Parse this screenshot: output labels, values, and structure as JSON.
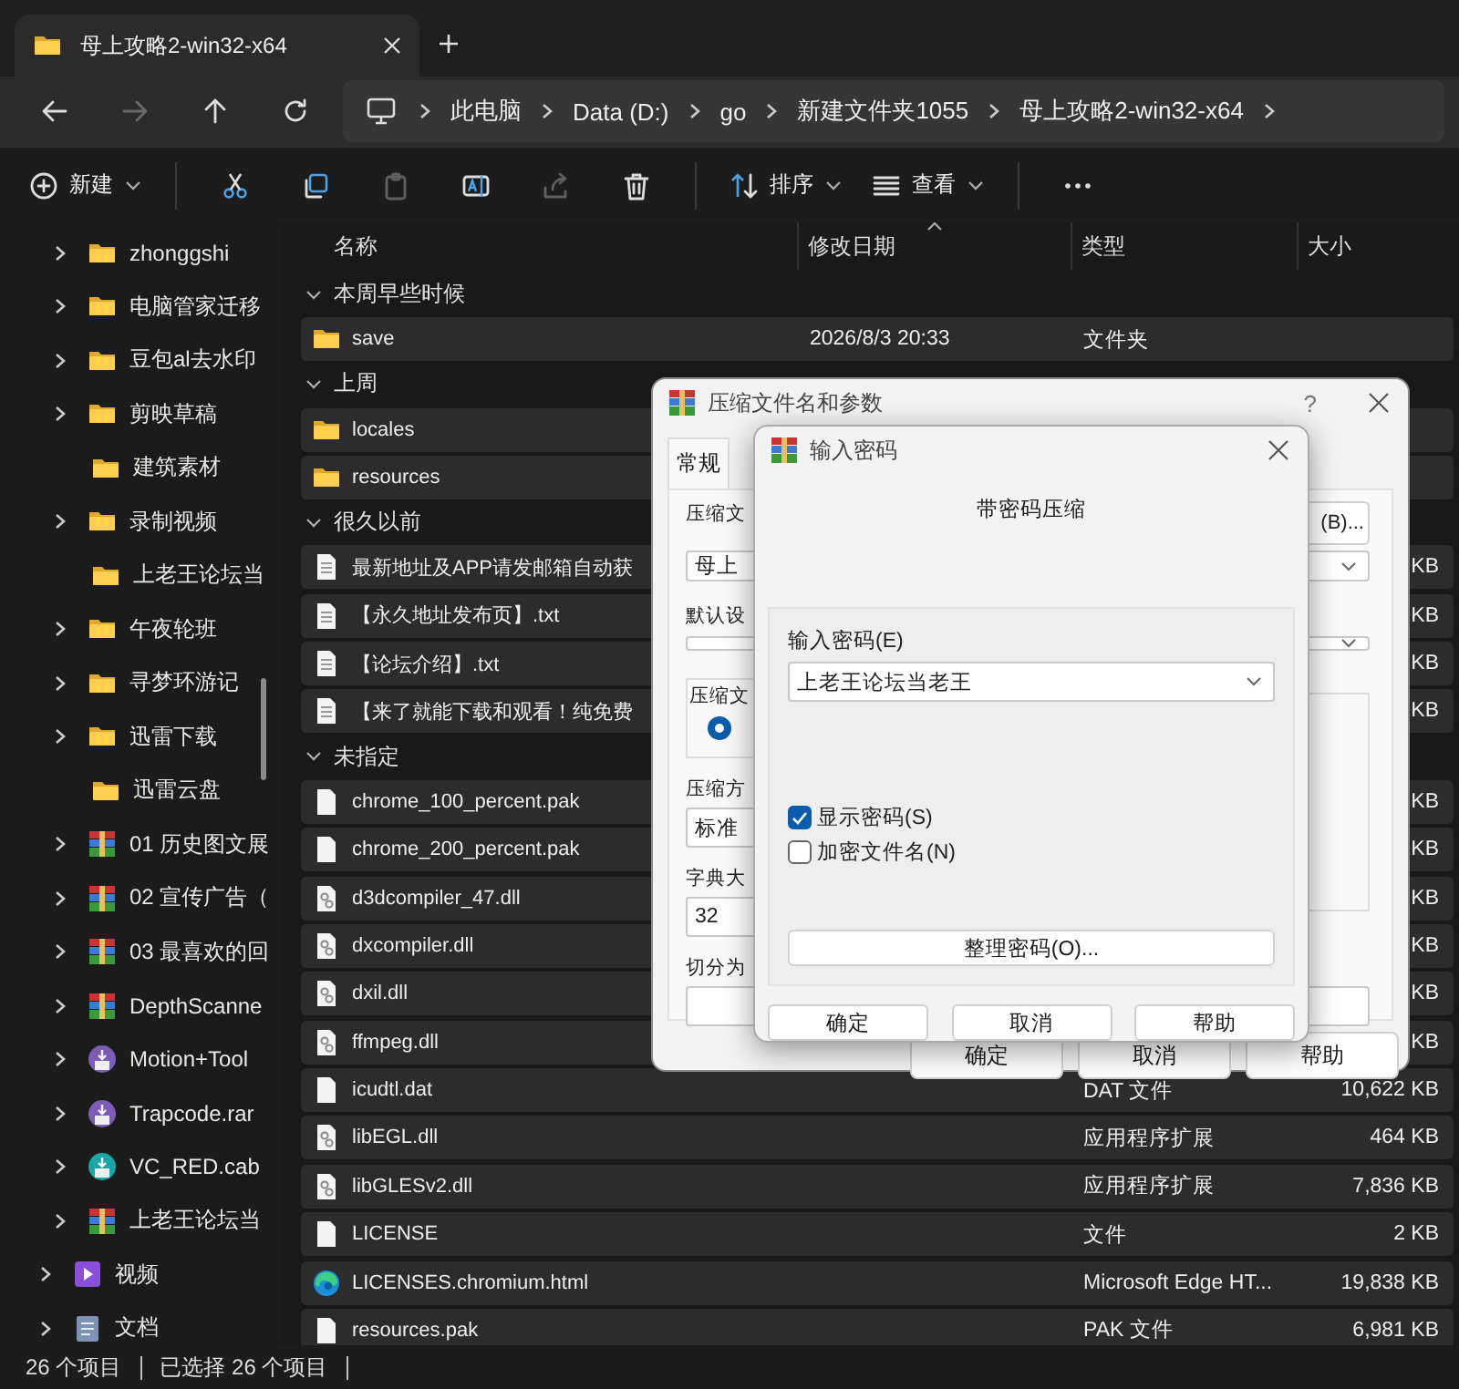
{
  "tab": {
    "title": "母上攻略2-win32-x64",
    "selected": true
  },
  "nav_buttons": [
    {
      "kind": "back",
      "disabled": false
    },
    {
      "kind": "forward",
      "disabled": true
    },
    {
      "kind": "up",
      "disabled": false
    },
    {
      "kind": "refresh",
      "disabled": false
    }
  ],
  "breadcrumb": [
    "此电脑",
    "Data (D:)",
    "go",
    "新建文件夹1055",
    "母上攻略2-win32-x64"
  ],
  "toolbar": [
    [
      {
        "kind": "new",
        "label": "新建",
        "disabled": false
      }
    ],
    [
      {
        "kind": "cut",
        "disabled": false
      },
      {
        "kind": "copy",
        "disabled": false
      },
      {
        "kind": "paste",
        "disabled": true
      },
      {
        "kind": "rename",
        "disabled": false
      },
      {
        "kind": "share",
        "disabled": true
      },
      {
        "kind": "delete",
        "disabled": false
      }
    ],
    [
      {
        "kind": "sort",
        "label": "排序",
        "disabled": false
      },
      {
        "kind": "view",
        "label": "查看",
        "disabled": false
      }
    ],
    [
      {
        "kind": "more",
        "disabled": false
      }
    ]
  ],
  "sidebar": {
    "items": [
      {
        "children": [
          {
            "label": "zhonggshi",
            "kind": "folder",
            "expandable": true
          },
          {
            "label": "电脑管家迁移",
            "kind": "folder",
            "expandable": true
          },
          {
            "label": "豆包al去水印",
            "kind": "folder",
            "expandable": true
          },
          {
            "label": "剪映草稿",
            "kind": "folder",
            "expandable": true
          },
          {
            "label": "建筑素材",
            "kind": "folder",
            "expandable": false
          },
          {
            "label": "录制视频",
            "kind": "folder",
            "expandable": true
          },
          {
            "label": "上老王论坛当",
            "kind": "folder",
            "expandable": false
          },
          {
            "label": "午夜轮班",
            "kind": "folder",
            "expandable": true
          },
          {
            "label": "寻梦环游记",
            "kind": "folder",
            "expandable": true
          },
          {
            "label": "迅雷下载",
            "kind": "folder",
            "expandable": true
          },
          {
            "label": "迅雷云盘",
            "kind": "folder",
            "expandable": false
          },
          {
            "label": "01 历史图文展",
            "kind": "archive",
            "expandable": true
          },
          {
            "label": "02 宣传广告（",
            "kind": "archive",
            "expandable": true
          },
          {
            "label": "03 最喜欢的回",
            "kind": "archive",
            "expandable": true
          },
          {
            "label": "DepthScanne",
            "kind": "archive",
            "expandable": true
          },
          {
            "label": "Motion+Tool",
            "kind": "package",
            "expandable": true
          },
          {
            "label": "Trapcode.rar",
            "kind": "package",
            "expandable": true
          },
          {
            "label": "VC_RED.cab",
            "kind": "cab",
            "expandable": true
          },
          {
            "label": "上老王论坛当",
            "kind": "archive",
            "expandable": true
          }
        ]
      },
      {
        "label": "视频",
        "kind": "video",
        "expandable": true
      },
      {
        "label": "文档",
        "kind": "doc",
        "expandable": true
      }
    ]
  },
  "columns": [
    {
      "label": "名称",
      "sorted": false
    },
    {
      "label": "修改日期",
      "sorted": true
    },
    {
      "label": "类型",
      "sorted": false
    },
    {
      "label": "大小",
      "sorted": false
    }
  ],
  "groups": [
    {
      "label": "本周早些时候",
      "expanded": true,
      "rows": [
        {
          "name": "save",
          "kind": "folder",
          "date": "2026/8/3 20:33",
          "type": "文件夹",
          "selected": true
        }
      ]
    },
    {
      "label": "上周",
      "expanded": true,
      "rows": [
        {
          "name": "locales",
          "kind": "folder",
          "selected": true
        },
        {
          "name": "resources",
          "kind": "folder",
          "selected": true
        }
      ]
    },
    {
      "label": "很久以前",
      "expanded": true,
      "rows": [
        {
          "name": "最新地址及APP请发邮箱自动获",
          "kind": "text",
          "size": "KB",
          "selected": true
        },
        {
          "name": "【永久地址发布页】.txt",
          "kind": "text",
          "size": "KB",
          "selected": true
        },
        {
          "name": "【论坛介绍】.txt",
          "kind": "text",
          "size": "KB",
          "selected": true
        },
        {
          "name": "【来了就能下载和观看！纯免费",
          "kind": "text",
          "size": "KB",
          "selected": true
        }
      ]
    },
    {
      "label": "未指定",
      "expanded": true,
      "rows": [
        {
          "name": "chrome_100_percent.pak",
          "kind": "file",
          "size": "KB",
          "selected": true
        },
        {
          "name": "chrome_200_percent.pak",
          "kind": "file",
          "size": "KB",
          "selected": true
        },
        {
          "name": "d3dcompiler_47.dll",
          "kind": "dll",
          "size": "KB",
          "selected": true
        },
        {
          "name": "dxcompiler.dll",
          "kind": "dll",
          "size": "KB",
          "selected": true
        },
        {
          "name": "dxil.dll",
          "kind": "dll",
          "size": "KB",
          "selected": true
        },
        {
          "name": "ffmpeg.dll",
          "kind": "dll",
          "size": "KB",
          "selected": true
        },
        {
          "name": "icudtl.dat",
          "kind": "file",
          "type": "DAT 文件",
          "size": "10,622 KB",
          "selected": true
        },
        {
          "name": "libEGL.dll",
          "kind": "dll",
          "type": "应用程序扩展",
          "size": "464 KB",
          "selected": true
        },
        {
          "name": "libGLESv2.dll",
          "kind": "dll",
          "type": "应用程序扩展",
          "size": "7,836 KB",
          "selected": true
        },
        {
          "name": "LICENSE",
          "kind": "file",
          "type": "文件",
          "size": "2 KB",
          "selected": true
        },
        {
          "name": "LICENSES.chromium.html",
          "kind": "edge",
          "type": "Microsoft Edge HT...",
          "size": "19,838 KB",
          "selected": true
        },
        {
          "name": "resources.pak",
          "kind": "file",
          "type": "PAK 文件",
          "size": "6,981 KB",
          "selected": true
        }
      ]
    }
  ],
  "status": [
    "26 个项目",
    "已选择 26 个项目"
  ],
  "compress_dialog": {
    "title": "压缩文件名和参数",
    "help": "?",
    "tabs": [
      {
        "label": "常规",
        "selected": true
      }
    ],
    "archive_label": "压缩文",
    "browse_button": "(B)...",
    "archive_name": "母上",
    "profile_label": "默认设",
    "format_label": "压缩文",
    "format_selected": true,
    "method_label": "压缩方",
    "method": "标准",
    "dict_label": "字典大",
    "dict": "32",
    "split_label": "切分为",
    "buttons": [
      "确定",
      "取消",
      "帮助"
    ]
  },
  "password_dialog": {
    "title": "输入密码",
    "heading": "带密码压缩",
    "password_label": "输入密码(E)",
    "password": "上老王论坛当老王",
    "options": [
      {
        "label": "显示密码(S)",
        "checked": true
      },
      {
        "label": "加密文件名(N)",
        "checked": false
      }
    ],
    "organize_button": "整理密码(O)...",
    "buttons": [
      "确定",
      "取消",
      "帮助"
    ]
  }
}
